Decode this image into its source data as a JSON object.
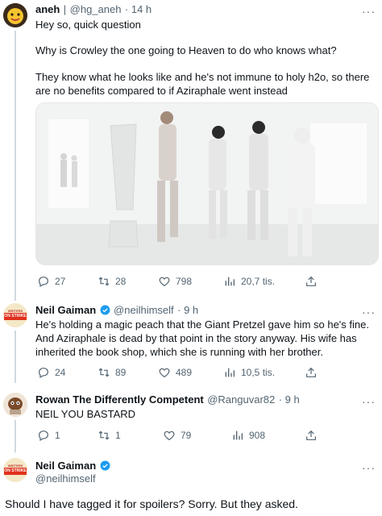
{
  "tweets": [
    {
      "display_name": "aneh",
      "handle_sep": "|",
      "handle": "@hg_aneh",
      "time": "· 14 h",
      "paragraphs": [
        "Hey so, quick question",
        "Why is Crowley the one going to Heaven to do who knows what?",
        "They know what he looks like and he's not immune to holy h2o, so there are no benefits compared to if Aziraphale went instead"
      ],
      "stats": {
        "replies": "27",
        "retweets": "28",
        "likes": "798",
        "views": "20,7 tis."
      }
    },
    {
      "display_name": "Neil Gaiman",
      "handle": "@neilhimself",
      "time": "· 9 h",
      "avatar_text": [
        "WRITERS GUILD",
        "ON STRIKE"
      ],
      "text": "He's holding a magic peach that the Giant Pretzel gave him so he's fine. And Aziraphale is dead by that point in the story anyway. His wife has inherited the book shop, which she is running with her brother.",
      "stats": {
        "replies": "24",
        "retweets": "89",
        "likes": "489",
        "views": "10,5 tis."
      }
    },
    {
      "display_name": "Rowan The Differently Competent",
      "handle": "@Ranguvar82",
      "time": "· 9 h",
      "text": "NEIL YOU BASTARD",
      "stats": {
        "replies": "1",
        "retweets": "1",
        "likes": "79",
        "views": "908"
      }
    },
    {
      "display_name": "Neil Gaiman",
      "handle": "@neilhimself",
      "avatar_text": [
        "WRITERS GUILD",
        "ON STRIKE"
      ],
      "text": "Should I have tagged it for spoilers? Sorry. But they asked."
    }
  ],
  "more_label": "···",
  "colors": {
    "text": "#0f1419",
    "secondary": "#536471",
    "verified": "#1d9bf0",
    "thread": "#cfd9de",
    "strike_badge": "#e0311d"
  }
}
